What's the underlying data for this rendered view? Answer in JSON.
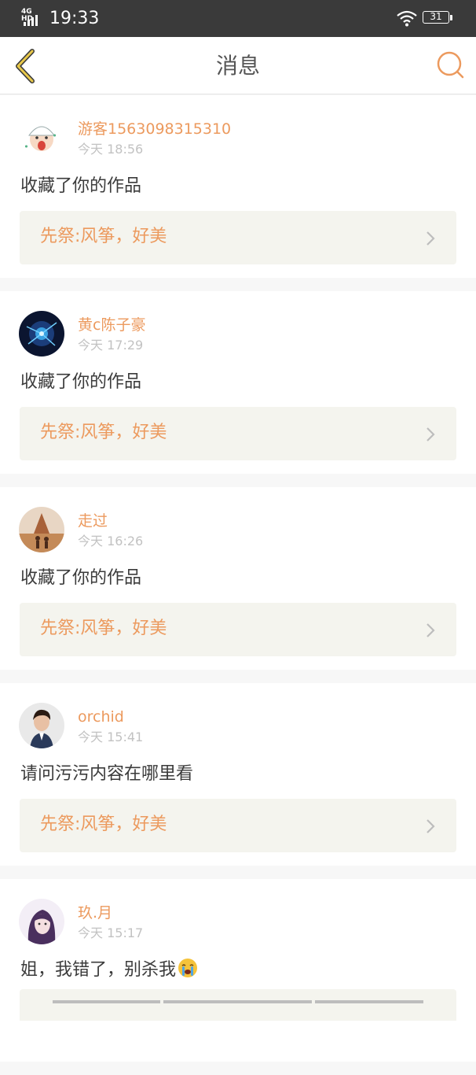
{
  "status_bar": {
    "network": "4G HD",
    "time": "19:33",
    "battery": "31"
  },
  "header": {
    "title": "消息",
    "back_icon": "chevron-left-icon",
    "search_icon": "search-icon"
  },
  "colors": {
    "accent": "#ec9a5e",
    "back": "#e0c040",
    "card_bg": "#ffffff",
    "work_bg": "#f4f4ee"
  },
  "messages": [
    {
      "name": "游客1563098315310",
      "time": "今天 18:56",
      "text": "收藏了你的作品",
      "work": "先祭:风筝，好美"
    },
    {
      "name": "黄c陈子豪",
      "time": "今天 17:29",
      "text": "收藏了你的作品",
      "work": "先祭:风筝，好美"
    },
    {
      "name": "走过",
      "time": "今天 16:26",
      "text": "收藏了你的作品",
      "work": "先祭:风筝，好美"
    },
    {
      "name": "orchid",
      "time": "今天 15:41",
      "text": "请问污污内容在哪里看",
      "work": "先祭:风筝，好美"
    },
    {
      "name": "玖.月",
      "time": "今天 15:17",
      "text": "姐，我错了，别杀我",
      "emoji": "crying-face-emoji"
    }
  ]
}
